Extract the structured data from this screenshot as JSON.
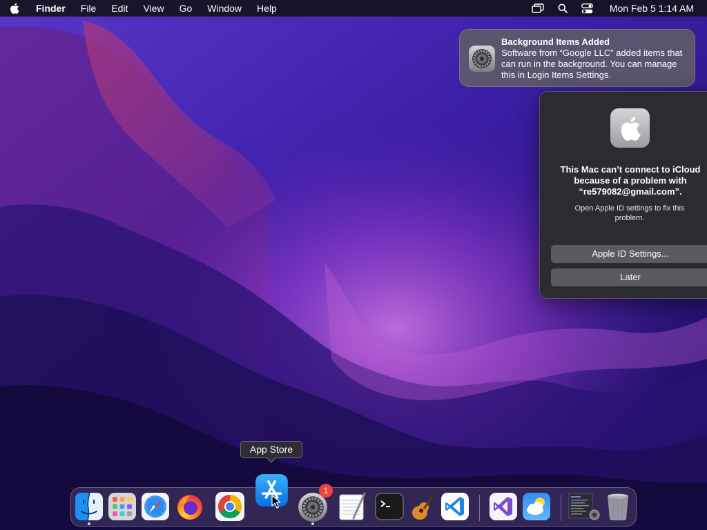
{
  "menubar": {
    "apple_icon": "apple-logo-icon",
    "app_name": "Finder",
    "menus": [
      "File",
      "Edit",
      "View",
      "Go",
      "Window",
      "Help"
    ],
    "status_icons": [
      "screen-mirroring-icon",
      "spotlight-search-icon",
      "control-center-icon"
    ],
    "clock": "Mon Feb 5  1:14 AM"
  },
  "notification": {
    "icon": "system-settings-gear-icon",
    "title": "Background Items Added",
    "body": "Software from “Google LLC” added items that can run in the background. You can manage this in Login Items Settings."
  },
  "icloud_alert": {
    "icon": "apple-logo-icon",
    "title": "This Mac can’t connect to iCloud because of a problem with “re579082@gmail.com”.",
    "message": "Open Apple ID settings to fix this problem.",
    "primary_button": "Apple ID Settings...",
    "secondary_button": "Later"
  },
  "tooltip": {
    "label": "App Store"
  },
  "dock": {
    "items": [
      {
        "name": "Finder",
        "icon": "finder-icon",
        "running": true
      },
      {
        "name": "Launchpad",
        "icon": "launchpad-icon",
        "running": false
      },
      {
        "name": "Safari",
        "icon": "safari-icon",
        "running": false
      },
      {
        "name": "Firefox",
        "icon": "firefox-icon",
        "running": false
      },
      {
        "name": "Google Chrome",
        "icon": "chrome-icon",
        "running": false
      },
      {
        "name": "App Store",
        "icon": "app-store-icon",
        "running": false,
        "hovered": true
      },
      {
        "name": "System Settings",
        "icon": "system-settings-icon",
        "running": true,
        "badge": "1"
      },
      {
        "name": "TextEdit",
        "icon": "textedit-icon",
        "running": false
      },
      {
        "name": "Terminal",
        "icon": "terminal-icon",
        "running": false
      },
      {
        "name": "GarageBand",
        "icon": "garageband-icon",
        "running": false
      },
      {
        "name": "Visual Studio Code",
        "icon": "vscode-icon",
        "running": false
      },
      {
        "name": "Visual Studio",
        "icon": "visual-studio-icon",
        "running": false
      },
      {
        "name": "Weather",
        "icon": "weather-icon",
        "running": false
      },
      {
        "name": "Screenshot folder",
        "icon": "folder-stack-icon",
        "running": false
      },
      {
        "name": "Trash",
        "icon": "trash-icon",
        "running": false
      }
    ]
  },
  "colors": {
    "badge": "#f0433a",
    "app_store_blue": "#1a8cf5",
    "vscode_blue": "#1e88e5"
  }
}
